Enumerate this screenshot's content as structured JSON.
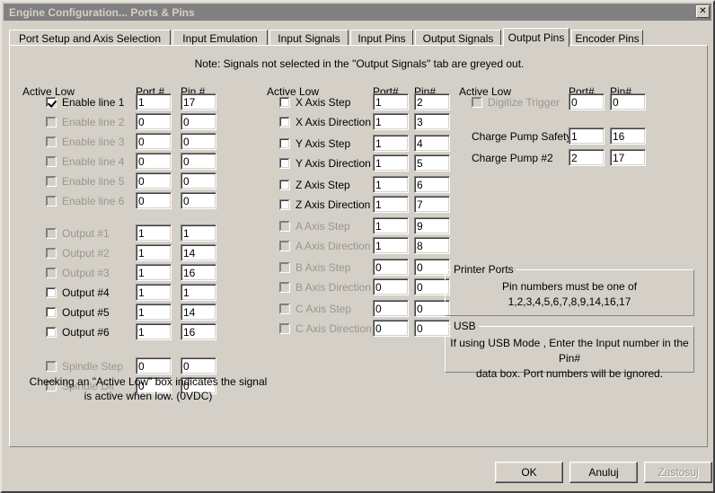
{
  "window": {
    "title": "Engine Configuration... Ports & Pins",
    "close_label": "✕"
  },
  "tabs": [
    {
      "label": "Port Setup and Axis Selection",
      "active": false
    },
    {
      "label": "Input Emulation",
      "active": false
    },
    {
      "label": "Input Signals",
      "active": false
    },
    {
      "label": "Input Pins",
      "active": false
    },
    {
      "label": "Output Signals",
      "active": false
    },
    {
      "label": "Output Pins",
      "active": true
    },
    {
      "label": "Encoder Pins",
      "active": false
    }
  ],
  "note": "Note: Signals not selected in the \"Output Signals\" tab are greyed out.",
  "columns": {
    "left": {
      "header_active_low": "Active Low",
      "header_port": "Port #",
      "header_pin": "Pin #",
      "rows": [
        {
          "label": "Enable line 1",
          "checked": true,
          "enabled": true,
          "port": "1",
          "pin": "17"
        },
        {
          "label": "Enable line 2",
          "checked": false,
          "enabled": false,
          "port": "0",
          "pin": "0"
        },
        {
          "label": "Enable line 3",
          "checked": false,
          "enabled": false,
          "port": "0",
          "pin": "0"
        },
        {
          "label": "Enable line 4",
          "checked": false,
          "enabled": false,
          "port": "0",
          "pin": "0"
        },
        {
          "label": "Enable line 5",
          "checked": false,
          "enabled": false,
          "port": "0",
          "pin": "0"
        },
        {
          "label": "Enable line 6",
          "checked": false,
          "enabled": false,
          "port": "0",
          "pin": "0"
        },
        {
          "label": "Output #1",
          "checked": false,
          "enabled": false,
          "port": "1",
          "pin": "1"
        },
        {
          "label": "Output #2",
          "checked": false,
          "enabled": false,
          "port": "1",
          "pin": "14"
        },
        {
          "label": "Output #3",
          "checked": false,
          "enabled": false,
          "port": "1",
          "pin": "16"
        },
        {
          "label": "Output #4",
          "checked": false,
          "enabled": true,
          "port": "1",
          "pin": "1"
        },
        {
          "label": "Output #5",
          "checked": false,
          "enabled": true,
          "port": "1",
          "pin": "14"
        },
        {
          "label": "Output #6",
          "checked": false,
          "enabled": true,
          "port": "1",
          "pin": "16"
        },
        {
          "label": "Spindle Step",
          "checked": false,
          "enabled": false,
          "port": "0",
          "pin": "0"
        },
        {
          "label": "Spindle Dir",
          "checked": false,
          "enabled": false,
          "port": "0",
          "pin": "0"
        }
      ]
    },
    "middle": {
      "header_active_low": "Active Low",
      "header_port": "Port#",
      "header_pin": "Pin#",
      "rows": [
        {
          "label": "X Axis Step",
          "checked": false,
          "enabled": true,
          "port": "1",
          "pin": "2"
        },
        {
          "label": "X Axis Direction",
          "checked": false,
          "enabled": true,
          "port": "1",
          "pin": "3"
        },
        {
          "label": "Y Axis Step",
          "checked": false,
          "enabled": true,
          "port": "1",
          "pin": "4"
        },
        {
          "label": "Y Axis Direction",
          "checked": false,
          "enabled": true,
          "port": "1",
          "pin": "5"
        },
        {
          "label": "Z Axis Step",
          "checked": false,
          "enabled": true,
          "port": "1",
          "pin": "6"
        },
        {
          "label": "Z Axis Direction",
          "checked": false,
          "enabled": true,
          "port": "1",
          "pin": "7"
        },
        {
          "label": "A Axis Step",
          "checked": false,
          "enabled": false,
          "port": "1",
          "pin": "9"
        },
        {
          "label": "A Axis Direction",
          "checked": false,
          "enabled": false,
          "port": "1",
          "pin": "8"
        },
        {
          "label": "B Axis Step",
          "checked": false,
          "enabled": false,
          "port": "0",
          "pin": "0"
        },
        {
          "label": "B Axis Direction",
          "checked": false,
          "enabled": false,
          "port": "0",
          "pin": "0"
        },
        {
          "label": "C Axis Step",
          "checked": false,
          "enabled": false,
          "port": "0",
          "pin": "0"
        },
        {
          "label": "C Axis Direction",
          "checked": false,
          "enabled": false,
          "port": "0",
          "pin": "0"
        }
      ]
    },
    "right": {
      "header_active_low": "Active Low",
      "header_port": "Port#",
      "header_pin": "Pin#",
      "rows": [
        {
          "label": "Digitize Trigger",
          "checkbox": true,
          "checked": false,
          "enabled": false,
          "port": "0",
          "pin": "0"
        },
        {
          "label": "Charge Pump Safety",
          "checkbox": false,
          "checked": false,
          "enabled": true,
          "port": "1",
          "pin": "16"
        },
        {
          "label": "Charge Pump #2",
          "checkbox": false,
          "checked": false,
          "enabled": true,
          "port": "2",
          "pin": "17"
        }
      ]
    }
  },
  "groupboxes": {
    "printer_ports": {
      "title": "Printer Ports",
      "line1": "Pin numbers must be one of",
      "line2": "1,2,3,4,5,6,7,8,9,14,16,17"
    },
    "usb": {
      "title": "USB",
      "line1": "If using USB Mode , Enter the Input number in the Pin#",
      "line2": "data box. Port numbers will be ignored."
    }
  },
  "footer_note": {
    "line1": "Checking an \"Active Low\" box indicates the signal",
    "line2": "is active when low. (0VDC)"
  },
  "buttons": [
    {
      "label": "OK",
      "enabled": true
    },
    {
      "label": "Anuluj",
      "enabled": true
    },
    {
      "label": "Zastosuj",
      "enabled": false
    }
  ],
  "colors": {
    "face": "#d4d0c8",
    "titlebar": "#808080",
    "disabled_text": "#9a968e"
  }
}
